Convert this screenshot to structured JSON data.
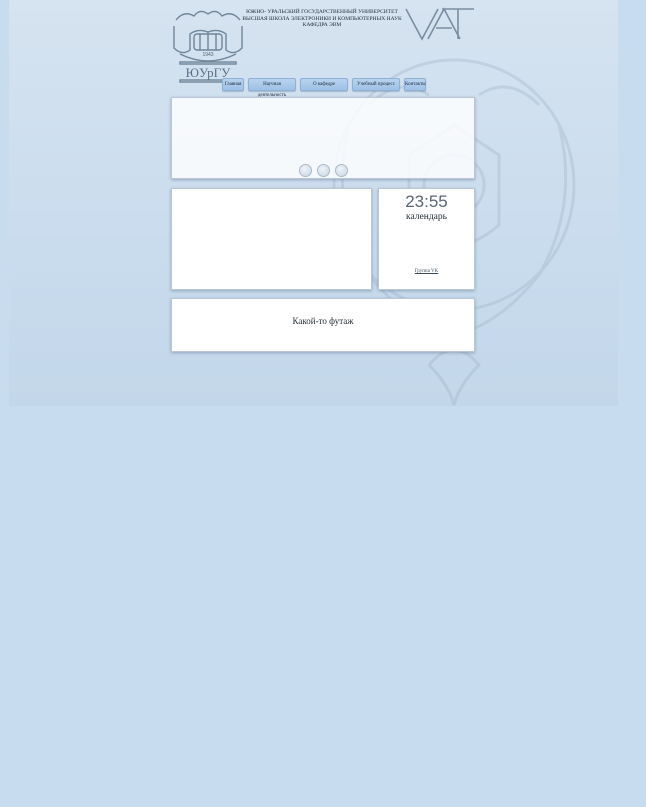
{
  "header": {
    "line1": "ЮЖНО- УРАЛЬСКИЙ ГОСУДАРСТВЕННЫЙ УНИВЕРСИТЕТ",
    "line2": "ВЫСШАЯ ШКОЛА ЭЛЕКТРОНИКИ И КОМПЬЮТЕРНЫХ НАУК",
    "line3": "КАФЕДРА ЭВМ",
    "logo_left_text": "ЮУрГУ",
    "logo_left_year": "1943",
    "logo_right_text": "VA"
  },
  "nav": {
    "items": [
      {
        "label": "Главная"
      },
      {
        "label": "Научная деятельность"
      },
      {
        "label": "О кафедре"
      },
      {
        "label": "Учебный процесс"
      },
      {
        "label": "Контакты"
      }
    ]
  },
  "sidebar": {
    "clock": "23:55",
    "calendar_label": "календарь",
    "vk_link": "Группа VK"
  },
  "footer": {
    "text": "Какой-то футаж"
  },
  "colors": {
    "page_bg": "#c8dcef",
    "nav_bg": "#a9c9ea"
  }
}
